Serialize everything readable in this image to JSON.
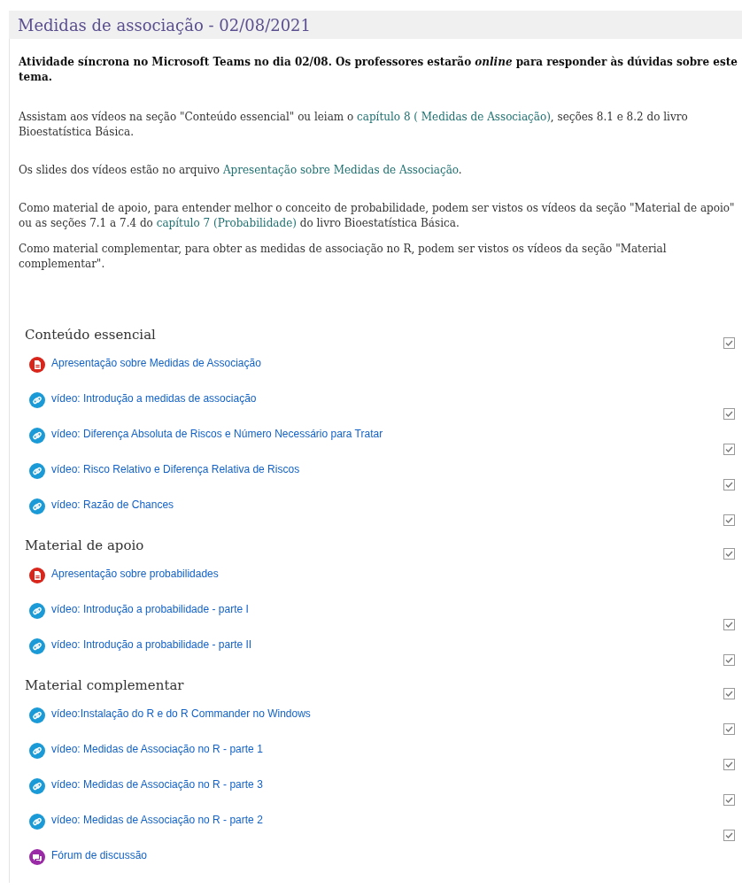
{
  "title": "Medidas de associação - 02/08/2021",
  "intro": [
    {
      "kind": "notice",
      "parts": [
        {
          "text": "Atividade síncrona no Microsoft Teams no dia 02/08. Os professores estarão *online* para responder às dúvidas sobre este tema."
        }
      ]
    },
    {
      "kind": "text",
      "parts": [
        {
          "text": "Assistam aos vídeos na seção \"Conteúdo essencial\" ou leiam o "
        },
        {
          "link": "capítulo 8 ( Medidas de Associação)"
        },
        {
          "text": ", seções 8.1 e 8.2 do livro Bioestatística Básica."
        }
      ]
    },
    {
      "kind": "text",
      "parts": [
        {
          "text": "Os slides dos vídeos estão no arquivo "
        },
        {
          "link": "Apresentação sobre Medidas de Associação"
        },
        {
          "text": "."
        }
      ]
    },
    {
      "kind": "text",
      "parts": [
        {
          "text": "Como material de apoio, para entender melhor o conceito de probabilidade, podem ser vistos os vídeos da seção \"Material de apoio\" ou as seções 7.1 a 7.4 do "
        },
        {
          "link": "capítulo 7 (Probabilidade)"
        },
        {
          "text": " do livro Bioestatística Básica."
        }
      ]
    },
    {
      "kind": "text",
      "parts": [
        {
          "text": "Como material complementar, para obter as medidas de associação no R, podem ser vistos os vídeos da seção \"Material complementar\"."
        }
      ]
    }
  ],
  "sections": [
    {
      "title": "Conteúdo essencial",
      "completed": true,
      "items": [
        {
          "kind": "pdf",
          "label": "Apresentação sobre Medidas de Associação"
        },
        {
          "kind": "url",
          "label": "vídeo: Introdução a medidas de associação",
          "completed": true
        },
        {
          "kind": "url",
          "label": "vídeo: Diferença Absoluta de Riscos e Número Necessário para Tratar",
          "completed": true
        },
        {
          "kind": "url",
          "label": "vídeo: Risco Relativo e Diferença Relativa de Riscos",
          "completed": true
        },
        {
          "kind": "url",
          "label": "vídeo: Razão de Chances",
          "completed": true
        }
      ]
    },
    {
      "title": "Material de apoio",
      "completed": true,
      "items": [
        {
          "kind": "pdf",
          "label": "Apresentação sobre probabilidades"
        },
        {
          "kind": "url",
          "label": "vídeo: Introdução a probabilidade - parte I",
          "completed": true
        },
        {
          "kind": "url",
          "label": "vídeo: Introdução a probabilidade - parte II",
          "completed": true
        }
      ]
    },
    {
      "title": "Material complementar",
      "completed": true,
      "items": [
        {
          "kind": "url",
          "label": "vídeo:Instalação do R e do R Commander no Windows",
          "completed": true
        },
        {
          "kind": "url",
          "label": "vídeo: Medidas de Associação no R - parte 1",
          "completed": true
        },
        {
          "kind": "url",
          "label": "vídeo: Medidas de Associação no R - parte 3",
          "completed": true
        },
        {
          "kind": "url",
          "label": "vídeo: Medidas de Associação no R - parte 2",
          "completed": true
        },
        {
          "kind": "forum",
          "label": "Fórum de discussão"
        }
      ]
    }
  ]
}
